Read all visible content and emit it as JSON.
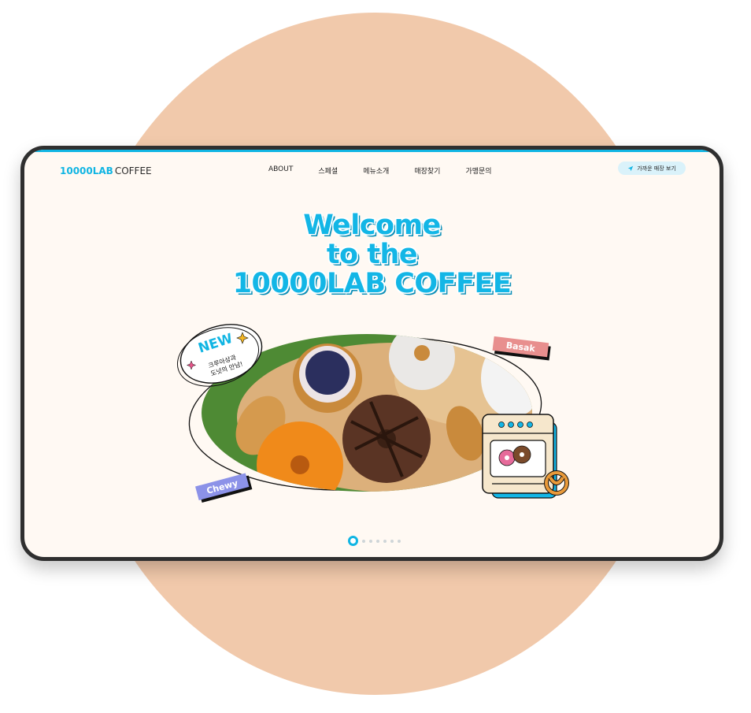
{
  "header": {
    "logo_accent": "10000LAB",
    "logo_rest": "COFFEE",
    "nav": [
      "ABOUT",
      "스페셜",
      "메뉴소개",
      "매장찾기",
      "가맹문의"
    ],
    "store_button": "가까운 매장 보기"
  },
  "hero": {
    "title_lines": [
      "Welcome",
      "to the",
      "10000LAB COFFEE"
    ],
    "badge_new": "NEW",
    "badge_text_1": "크루아상과",
    "badge_text_2": "도넛의 만남!",
    "tag_basak": "Basak",
    "tag_chewy": "Chewy"
  },
  "carousel": {
    "total": 7,
    "active_index": 0
  },
  "colors": {
    "accent": "#11b5e3",
    "background_circle": "#f1c9ab",
    "screen_bg": "#fff9f3"
  }
}
